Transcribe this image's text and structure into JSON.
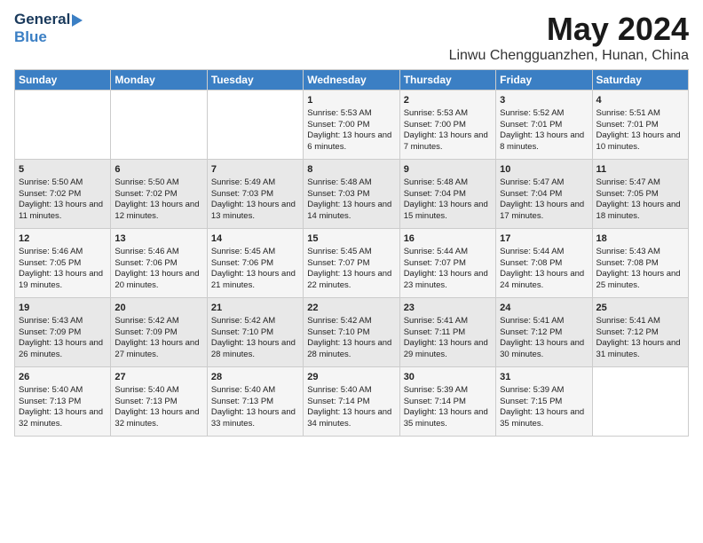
{
  "header": {
    "logo_line1": "General",
    "logo_line2": "Blue",
    "month": "May 2024",
    "location": "Linwu Chengguanzhen, Hunan, China"
  },
  "days_of_week": [
    "Sunday",
    "Monday",
    "Tuesday",
    "Wednesday",
    "Thursday",
    "Friday",
    "Saturday"
  ],
  "weeks": [
    [
      {
        "day": "",
        "sunrise": "",
        "sunset": "",
        "daylight": ""
      },
      {
        "day": "",
        "sunrise": "",
        "sunset": "",
        "daylight": ""
      },
      {
        "day": "",
        "sunrise": "",
        "sunset": "",
        "daylight": ""
      },
      {
        "day": "1",
        "sunrise": "Sunrise: 5:53 AM",
        "sunset": "Sunset: 7:00 PM",
        "daylight": "Daylight: 13 hours and 6 minutes."
      },
      {
        "day": "2",
        "sunrise": "Sunrise: 5:53 AM",
        "sunset": "Sunset: 7:00 PM",
        "daylight": "Daylight: 13 hours and 7 minutes."
      },
      {
        "day": "3",
        "sunrise": "Sunrise: 5:52 AM",
        "sunset": "Sunset: 7:01 PM",
        "daylight": "Daylight: 13 hours and 8 minutes."
      },
      {
        "day": "4",
        "sunrise": "Sunrise: 5:51 AM",
        "sunset": "Sunset: 7:01 PM",
        "daylight": "Daylight: 13 hours and 10 minutes."
      }
    ],
    [
      {
        "day": "5",
        "sunrise": "Sunrise: 5:50 AM",
        "sunset": "Sunset: 7:02 PM",
        "daylight": "Daylight: 13 hours and 11 minutes."
      },
      {
        "day": "6",
        "sunrise": "Sunrise: 5:50 AM",
        "sunset": "Sunset: 7:02 PM",
        "daylight": "Daylight: 13 hours and 12 minutes."
      },
      {
        "day": "7",
        "sunrise": "Sunrise: 5:49 AM",
        "sunset": "Sunset: 7:03 PM",
        "daylight": "Daylight: 13 hours and 13 minutes."
      },
      {
        "day": "8",
        "sunrise": "Sunrise: 5:48 AM",
        "sunset": "Sunset: 7:03 PM",
        "daylight": "Daylight: 13 hours and 14 minutes."
      },
      {
        "day": "9",
        "sunrise": "Sunrise: 5:48 AM",
        "sunset": "Sunset: 7:04 PM",
        "daylight": "Daylight: 13 hours and 15 minutes."
      },
      {
        "day": "10",
        "sunrise": "Sunrise: 5:47 AM",
        "sunset": "Sunset: 7:04 PM",
        "daylight": "Daylight: 13 hours and 17 minutes."
      },
      {
        "day": "11",
        "sunrise": "Sunrise: 5:47 AM",
        "sunset": "Sunset: 7:05 PM",
        "daylight": "Daylight: 13 hours and 18 minutes."
      }
    ],
    [
      {
        "day": "12",
        "sunrise": "Sunrise: 5:46 AM",
        "sunset": "Sunset: 7:05 PM",
        "daylight": "Daylight: 13 hours and 19 minutes."
      },
      {
        "day": "13",
        "sunrise": "Sunrise: 5:46 AM",
        "sunset": "Sunset: 7:06 PM",
        "daylight": "Daylight: 13 hours and 20 minutes."
      },
      {
        "day": "14",
        "sunrise": "Sunrise: 5:45 AM",
        "sunset": "Sunset: 7:06 PM",
        "daylight": "Daylight: 13 hours and 21 minutes."
      },
      {
        "day": "15",
        "sunrise": "Sunrise: 5:45 AM",
        "sunset": "Sunset: 7:07 PM",
        "daylight": "Daylight: 13 hours and 22 minutes."
      },
      {
        "day": "16",
        "sunrise": "Sunrise: 5:44 AM",
        "sunset": "Sunset: 7:07 PM",
        "daylight": "Daylight: 13 hours and 23 minutes."
      },
      {
        "day": "17",
        "sunrise": "Sunrise: 5:44 AM",
        "sunset": "Sunset: 7:08 PM",
        "daylight": "Daylight: 13 hours and 24 minutes."
      },
      {
        "day": "18",
        "sunrise": "Sunrise: 5:43 AM",
        "sunset": "Sunset: 7:08 PM",
        "daylight": "Daylight: 13 hours and 25 minutes."
      }
    ],
    [
      {
        "day": "19",
        "sunrise": "Sunrise: 5:43 AM",
        "sunset": "Sunset: 7:09 PM",
        "daylight": "Daylight: 13 hours and 26 minutes."
      },
      {
        "day": "20",
        "sunrise": "Sunrise: 5:42 AM",
        "sunset": "Sunset: 7:09 PM",
        "daylight": "Daylight: 13 hours and 27 minutes."
      },
      {
        "day": "21",
        "sunrise": "Sunrise: 5:42 AM",
        "sunset": "Sunset: 7:10 PM",
        "daylight": "Daylight: 13 hours and 28 minutes."
      },
      {
        "day": "22",
        "sunrise": "Sunrise: 5:42 AM",
        "sunset": "Sunset: 7:10 PM",
        "daylight": "Daylight: 13 hours and 28 minutes."
      },
      {
        "day": "23",
        "sunrise": "Sunrise: 5:41 AM",
        "sunset": "Sunset: 7:11 PM",
        "daylight": "Daylight: 13 hours and 29 minutes."
      },
      {
        "day": "24",
        "sunrise": "Sunrise: 5:41 AM",
        "sunset": "Sunset: 7:12 PM",
        "daylight": "Daylight: 13 hours and 30 minutes."
      },
      {
        "day": "25",
        "sunrise": "Sunrise: 5:41 AM",
        "sunset": "Sunset: 7:12 PM",
        "daylight": "Daylight: 13 hours and 31 minutes."
      }
    ],
    [
      {
        "day": "26",
        "sunrise": "Sunrise: 5:40 AM",
        "sunset": "Sunset: 7:13 PM",
        "daylight": "Daylight: 13 hours and 32 minutes."
      },
      {
        "day": "27",
        "sunrise": "Sunrise: 5:40 AM",
        "sunset": "Sunset: 7:13 PM",
        "daylight": "Daylight: 13 hours and 32 minutes."
      },
      {
        "day": "28",
        "sunrise": "Sunrise: 5:40 AM",
        "sunset": "Sunset: 7:13 PM",
        "daylight": "Daylight: 13 hours and 33 minutes."
      },
      {
        "day": "29",
        "sunrise": "Sunrise: 5:40 AM",
        "sunset": "Sunset: 7:14 PM",
        "daylight": "Daylight: 13 hours and 34 minutes."
      },
      {
        "day": "30",
        "sunrise": "Sunrise: 5:39 AM",
        "sunset": "Sunset: 7:14 PM",
        "daylight": "Daylight: 13 hours and 35 minutes."
      },
      {
        "day": "31",
        "sunrise": "Sunrise: 5:39 AM",
        "sunset": "Sunset: 7:15 PM",
        "daylight": "Daylight: 13 hours and 35 minutes."
      },
      {
        "day": "",
        "sunrise": "",
        "sunset": "",
        "daylight": ""
      }
    ]
  ]
}
